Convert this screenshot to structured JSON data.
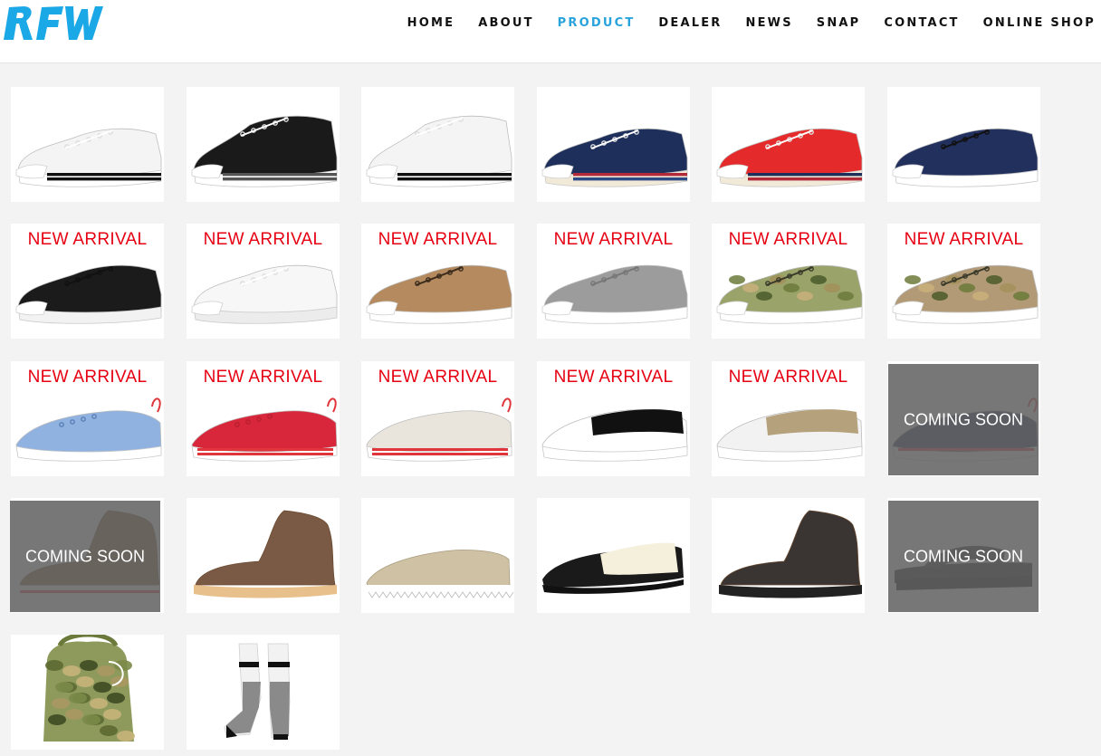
{
  "brand": {
    "name": "RFW",
    "color": "#1ba8e6"
  },
  "nav": {
    "items": [
      {
        "label": "HOME",
        "active": false
      },
      {
        "label": "ABOUT",
        "active": false
      },
      {
        "label": "PRODUCT",
        "active": true
      },
      {
        "label": "DEALER",
        "active": false
      },
      {
        "label": "NEWS",
        "active": false
      },
      {
        "label": "SNAP",
        "active": false
      },
      {
        "label": "CONTACT",
        "active": false
      },
      {
        "label": "ONLINE SHOP",
        "active": false
      }
    ],
    "active_color": "#29a3dc"
  },
  "badges": {
    "new_arrival": "NEW ARRIVAL",
    "coming_soon": "COMING SOON",
    "new_color": "#e60012"
  },
  "products": [
    {
      "kind": "sneaker-low",
      "upper": "#f4f4f4",
      "sole": "#ffffff",
      "stripes": [
        "#111111",
        "#111111"
      ],
      "laces": "#ffffff",
      "badge": ""
    },
    {
      "kind": "sneaker-high",
      "upper": "#1a1a1a",
      "sole": "#ffffff",
      "stripes": [
        "#555555",
        "#555555"
      ],
      "laces": "#ffffff",
      "badge": ""
    },
    {
      "kind": "sneaker-high",
      "upper": "#f4f4f4",
      "sole": "#ffffff",
      "stripes": [
        "#111111",
        "#111111"
      ],
      "laces": "#ffffff",
      "badge": ""
    },
    {
      "kind": "sneaker-low",
      "upper": "#1d2f5a",
      "sole": "#f1ead8",
      "stripes": [
        "#b12a3a",
        "#2e4a85"
      ],
      "laces": "#ffffff",
      "badge": ""
    },
    {
      "kind": "sneaker-low",
      "upper": "#e42a2a",
      "sole": "#f1ead8",
      "stripes": [
        "#1d2f5a",
        "#b12a3a"
      ],
      "laces": "#ffffff",
      "badge": ""
    },
    {
      "kind": "sneaker-low",
      "upper": "#22305e",
      "sole": "#ffffff",
      "stripes": [],
      "laces": "#111111",
      "badge": ""
    },
    {
      "kind": "sneaker-low",
      "upper": "#1b1b1b",
      "sole": "#f2f2f2",
      "stripes": [],
      "laces": "#111111",
      "badge": "new"
    },
    {
      "kind": "sneaker-low",
      "upper": "#f7f7f7",
      "sole": "#ececec",
      "stripes": [],
      "laces": "#ffffff",
      "badge": "new"
    },
    {
      "kind": "sneaker-low",
      "upper": "#b48a5e",
      "sole": "#ffffff",
      "stripes": [],
      "laces": "#3a2b1c",
      "badge": "new"
    },
    {
      "kind": "sneaker-low",
      "upper": "#9c9c9c",
      "sole": "#ffffff",
      "stripes": [],
      "laces": "#777777",
      "badge": "new"
    },
    {
      "kind": "camo-low",
      "upper": "#9aa36a",
      "sole": "#ffffff",
      "stripes": [],
      "laces": "#3a3a2a",
      "badge": "new"
    },
    {
      "kind": "camo-low",
      "upper": "#b39a76",
      "sole": "#ffffff",
      "stripes": [],
      "laces": "#3a3a2a",
      "badge": "new"
    },
    {
      "kind": "deck",
      "upper": "#8fb2e0",
      "sole": "#ffffff",
      "stripes": [],
      "laces": "#5b7fb5",
      "badge": "new"
    },
    {
      "kind": "deck",
      "upper": "#d8273b",
      "sole": "#ffffff",
      "stripes": [
        "#e0353a",
        "#e0353a"
      ],
      "laces": "#b81f2e",
      "badge": "new"
    },
    {
      "kind": "deck",
      "upper": "#e9e5dc",
      "sole": "#ffffff",
      "stripes": [
        "#e0353a",
        "#e0353a"
      ],
      "laces": "#e9e5dc",
      "badge": "new"
    },
    {
      "kind": "slipon",
      "upper": "#ffffff",
      "sole": "#ffffff",
      "stripes": [],
      "laces": "#111111",
      "badge": "new"
    },
    {
      "kind": "slipon",
      "upper": "#f2f2f2",
      "sole": "#ffffff",
      "stripes": [],
      "laces": "#b5a27d",
      "badge": "new"
    },
    {
      "kind": "deck",
      "upper": "#1f2c52",
      "sole": "#ffffff",
      "stripes": [
        "#e0353a"
      ],
      "laces": "#1f2c52",
      "badge": "soon"
    },
    {
      "kind": "boot",
      "upper": "#8b5a2b",
      "sole": "#ffffff",
      "stripes": [
        "#e0353a"
      ],
      "laces": "#8b5a2b",
      "badge": "soon"
    },
    {
      "kind": "boot",
      "upper": "#7a5a44",
      "sole": "#e8c08c",
      "stripes": [],
      "laces": "#7a5a44",
      "badge": ""
    },
    {
      "kind": "moc",
      "upper": "#cfc2a4",
      "sole": "#ffffff",
      "stripes": [],
      "laces": "#cfc2a4",
      "badge": ""
    },
    {
      "kind": "derby",
      "upper": "#1a1a1a",
      "sole": "#1a1a1a",
      "stripes": [],
      "laces": "#f5f0dc",
      "badge": ""
    },
    {
      "kind": "boot",
      "upper": "#3a3533",
      "sole": "#222222",
      "stripes": [],
      "laces": "#3a3533",
      "badge": ""
    },
    {
      "kind": "sandal",
      "upper": "#111111",
      "sole": "#111111",
      "stripes": [],
      "laces": "#111111",
      "badge": "soon"
    },
    {
      "kind": "bag",
      "upper": "#8d9a5c",
      "sole": "#ffffff",
      "stripes": [],
      "laces": "#ffffff",
      "badge": ""
    },
    {
      "kind": "socks",
      "upper": "#8a8a8a",
      "sole": "#111111",
      "stripes": [],
      "laces": "#ffffff",
      "badge": ""
    }
  ]
}
